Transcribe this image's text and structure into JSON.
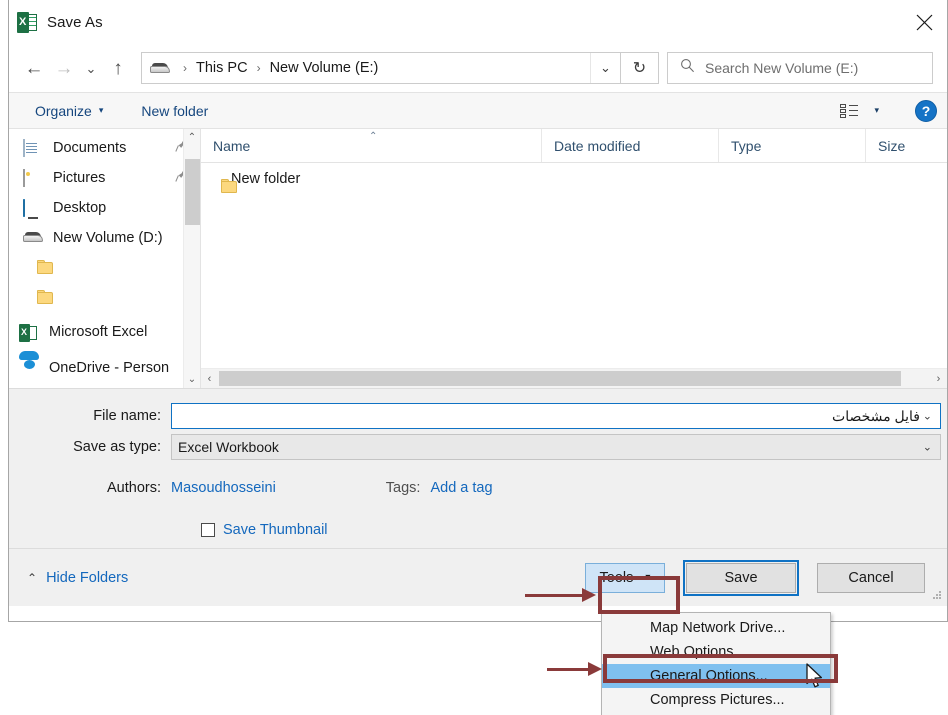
{
  "window": {
    "title": "Save As",
    "app_icon": "excel-icon",
    "close_label": "✕"
  },
  "nav": {
    "back": "←",
    "forward": "→",
    "recent": "⌄",
    "up": "↑",
    "refresh": "↻",
    "dropdown": "⌄"
  },
  "address": {
    "drive_icon": "drive-icon",
    "separator": "›",
    "crumbs": [
      "This PC",
      "New Volume (E:)"
    ]
  },
  "search": {
    "icon": "search-icon",
    "placeholder": "Search New Volume (E:)"
  },
  "toolbar": {
    "organize": "Organize",
    "organize_caret": "▾",
    "new_folder": "New folder",
    "view_caret": "▾",
    "help": "?"
  },
  "sidebar": {
    "items": [
      {
        "label": "Documents",
        "icon": "document-icon",
        "pinned": true,
        "pin": "📌"
      },
      {
        "label": "Pictures",
        "icon": "picture-icon",
        "pinned": true,
        "pin": "📌"
      },
      {
        "label": "Desktop",
        "icon": "desktop-icon",
        "pinned": false,
        "pin": ""
      },
      {
        "label": "New Volume (D:)",
        "icon": "drive-icon",
        "pinned": false,
        "pin": ""
      },
      {
        "label": "",
        "icon": "folder-icon",
        "pinned": false,
        "pin": ""
      },
      {
        "label": "",
        "icon": "folder-icon",
        "pinned": false,
        "pin": ""
      },
      {
        "label": "Microsoft Excel",
        "icon": "excel-icon",
        "pinned": false,
        "pin": ""
      },
      {
        "label": "OneDrive - Person",
        "icon": "onedrive-icon",
        "pinned": false,
        "pin": ""
      }
    ],
    "scroll_up": "⌃",
    "scroll_down": "⌄"
  },
  "file_list": {
    "columns": [
      "Name",
      "Date modified",
      "Type",
      "Size"
    ],
    "sort_caret": "⌃",
    "rows": [
      {
        "name": "New folder",
        "date_modified": "",
        "type": "",
        "size": "",
        "icon": "folder-icon"
      }
    ],
    "hscroll_left": "‹",
    "hscroll_right": "›"
  },
  "form": {
    "file_name_label": "File name:",
    "file_name_value": "فایل مشخصات",
    "save_as_type_label": "Save as type:",
    "save_as_type_value": "Excel Workbook",
    "combo_caret": "⌄",
    "authors_label": "Authors:",
    "authors_value": "Masoudhosseini",
    "tags_label": "Tags:",
    "tags_value": "Add a tag",
    "save_thumbnail_label": "Save Thumbnail",
    "save_thumbnail_checked": false
  },
  "footer": {
    "hide_folders": "Hide Folders",
    "hide_folders_caret": "⌃",
    "tools": "Tools",
    "tools_caret": "▾",
    "save": "Save",
    "cancel": "Cancel"
  },
  "tools_menu": {
    "items": [
      {
        "label": "Map Network Drive...",
        "selected": false
      },
      {
        "label": "Web Options...",
        "selected": false
      },
      {
        "label": "General Options...",
        "selected": true
      },
      {
        "label": "Compress Pictures...",
        "selected": false
      }
    ]
  },
  "annotations": {
    "color": "#8a3a3a",
    "highlight_color": "#7fc0ef",
    "focus_color": "#0f72c4",
    "boxes": [
      "tools-button",
      "general-options-menu-item"
    ],
    "arrows": [
      "arrow-to-tools-button",
      "arrow-to-general-options"
    ]
  }
}
